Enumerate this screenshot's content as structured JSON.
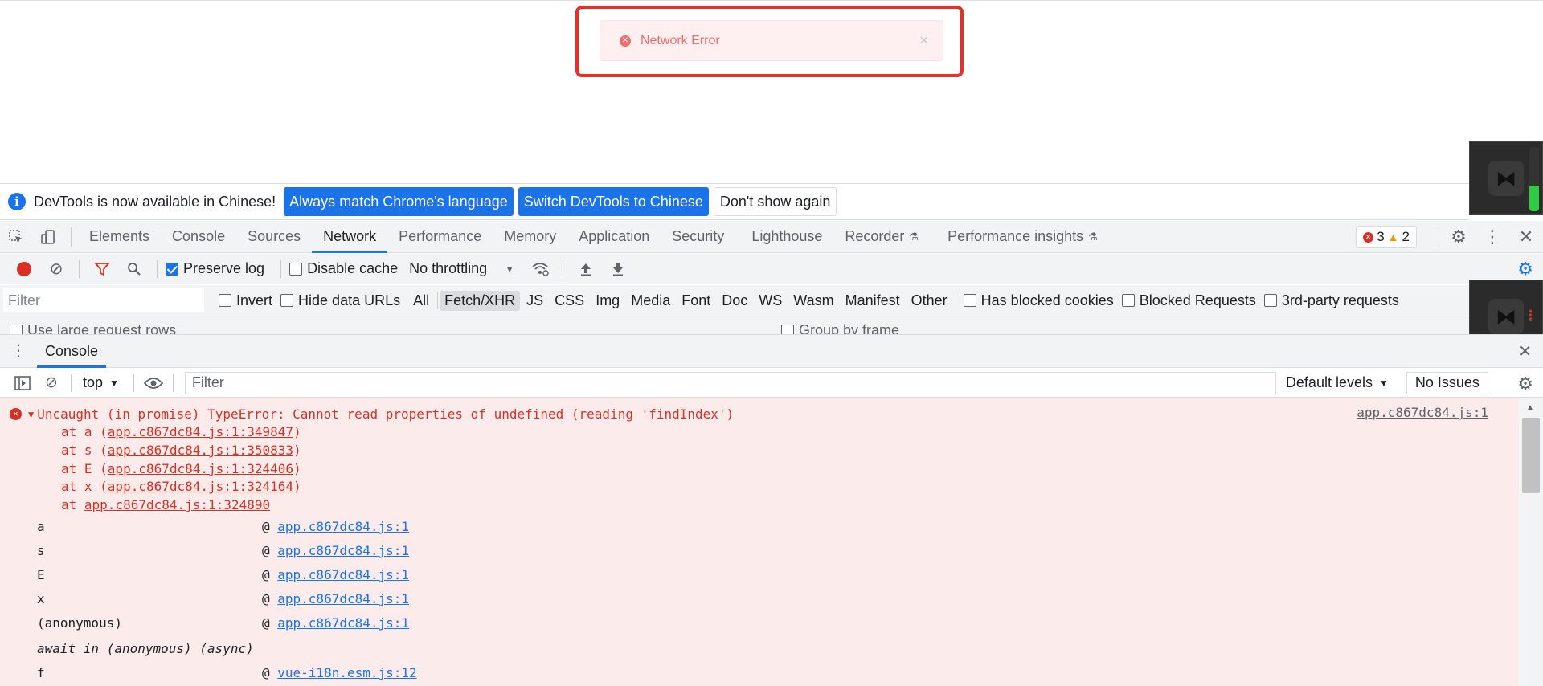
{
  "toast": {
    "message": "Network Error",
    "close_glyph": "×"
  },
  "infobar": {
    "text": "DevTools is now available in Chinese!",
    "btn_match": "Always match Chrome's language",
    "btn_switch": "Switch DevTools to Chinese",
    "btn_dismiss": "Don't show again"
  },
  "tabs": [
    {
      "label": "Elements"
    },
    {
      "label": "Console"
    },
    {
      "label": "Sources"
    },
    {
      "label": "Network"
    },
    {
      "label": "Performance"
    },
    {
      "label": "Memory"
    },
    {
      "label": "Application"
    },
    {
      "label": "Security"
    },
    {
      "label": "Lighthouse"
    },
    {
      "label": "Recorder"
    },
    {
      "label": "Performance insights"
    }
  ],
  "active_tab": "Network",
  "issues": {
    "errors": "3",
    "warnings": "2"
  },
  "network_toolbar": {
    "preserve_log": "Preserve log",
    "preserve_log_checked": true,
    "disable_cache": "Disable cache",
    "throttling": "No throttling"
  },
  "filter_row": {
    "placeholder": "Filter",
    "invert": "Invert",
    "hide_data_urls": "Hide data URLs",
    "types": [
      "All",
      "Fetch/XHR",
      "JS",
      "CSS",
      "Img",
      "Media",
      "Font",
      "Doc",
      "WS",
      "Wasm",
      "Manifest",
      "Other"
    ],
    "selected_type": "Fetch/XHR",
    "has_blocked_cookies": "Has blocked cookies",
    "blocked_requests": "Blocked Requests",
    "third_party": "3rd-party requests"
  },
  "cut_row": {
    "large_rows": "Use large request rows",
    "group_by_frame": "Group by frame"
  },
  "drawer": {
    "tab": "Console"
  },
  "console_toolbar": {
    "context": "top",
    "filter_placeholder": "Filter",
    "levels": "Default levels",
    "no_issues": "No Issues"
  },
  "error": {
    "message": "Uncaught (in promise) TypeError: Cannot read properties of undefined (reading 'findIndex')",
    "source": "app.c867dc84.js:1",
    "stack": [
      {
        "prefix": "at a (",
        "link": "app.c867dc84.js:1:349847",
        "suffix": ")"
      },
      {
        "prefix": "at s (",
        "link": "app.c867dc84.js:1:350833",
        "suffix": ")"
      },
      {
        "prefix": "at E (",
        "link": "app.c867dc84.js:1:324406",
        "suffix": ")"
      },
      {
        "prefix": "at x (",
        "link": "app.c867dc84.js:1:324164",
        "suffix": ")"
      },
      {
        "prefix": "at ",
        "link": "app.c867dc84.js:1:324890",
        "suffix": ""
      }
    ],
    "trace": [
      {
        "fn": "a",
        "link": "app.c867dc84.js:1"
      },
      {
        "fn": "s",
        "link": "app.c867dc84.js:1"
      },
      {
        "fn": "E",
        "link": "app.c867dc84.js:1"
      },
      {
        "fn": "x",
        "link": "app.c867dc84.js:1"
      },
      {
        "fn": "(anonymous)",
        "link": "app.c867dc84.js:1"
      }
    ],
    "async_label": "await in (anonymous) (async)",
    "trace_after": [
      {
        "fn": "f",
        "link": "vue-i18n.esm.js:12"
      }
    ]
  }
}
